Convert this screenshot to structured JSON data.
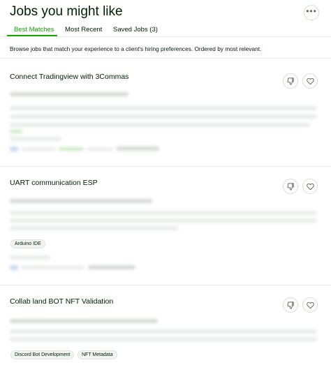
{
  "header": {
    "title": "Jobs you might like",
    "more_icon": "ellipsis-icon"
  },
  "tabs": [
    {
      "label": "Best Matches",
      "active": true
    },
    {
      "label": "Most Recent",
      "active": false
    },
    {
      "label": "Saved Jobs (3)",
      "active": false
    }
  ],
  "description": "Browse jobs that match your experience to a client's hiring preferences. Ordered by most relevant.",
  "jobs": [
    {
      "title": "Connect Tradingview with 3Commas",
      "skills": []
    },
    {
      "title": "UART communication ESP",
      "skills": [
        "Arduino IDE"
      ]
    },
    {
      "title": "Collab land BOT NFT Validation",
      "skills": [
        "Discord Bot Development",
        "NFT Metadata"
      ]
    }
  ],
  "colors": {
    "accent": "#14a800",
    "text": "#001e00",
    "border": "#e4ebe4"
  },
  "icons": {
    "dislike": "thumbs-down-icon",
    "save": "heart-icon"
  }
}
